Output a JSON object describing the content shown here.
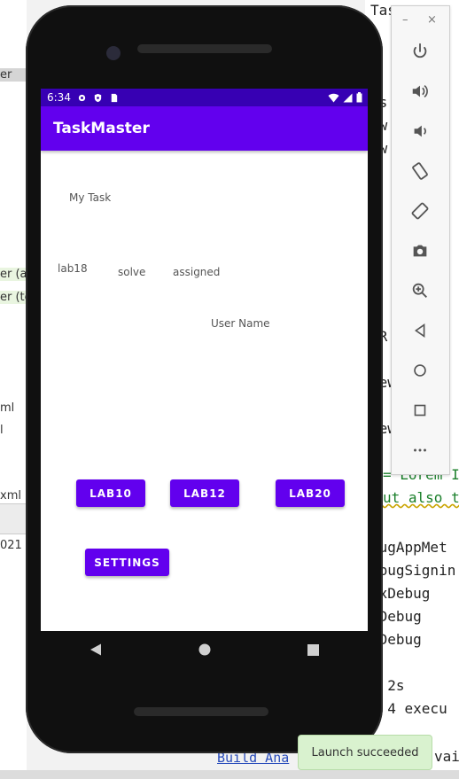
{
  "ide": {
    "left_rows": [
      {
        "text": "er",
        "style": "sel"
      },
      {
        "text": "er (ar",
        "style": "green"
      },
      {
        "text": "er (te",
        "style": "green"
      },
      {
        "text": "ml",
        "style": ""
      },
      {
        "text": "l",
        "style": ""
      },
      {
        "text": "xml",
        "style": ""
      },
      {
        "text": "021",
        "style": ""
      }
    ],
    "right_lines": [
      {
        "text": "Tas",
        "style": ""
      },
      {
        "text": "s",
        "style": ""
      },
      {
        "text": "s",
        "style": ""
      },
      {
        "text": "ks",
        "style": ""
      },
      {
        "text": "ow.",
        "style": ""
      },
      {
        "text": "ow.",
        "style": ""
      },
      {
        "text": "eR.",
        "style": ""
      },
      {
        "text": "tew",
        "style": ""
      },
      {
        "text": "Lew",
        "style": ""
      },
      {
        "text": "e",
        "style": ""
      },
      {
        "text": "= Lorem I",
        "style": "str"
      },
      {
        "text": "ut also t",
        "style": "str"
      },
      {
        "text": "bugAppMet",
        "style": ""
      },
      {
        "text": "ebugSignin",
        "style": ""
      },
      {
        "text": "exDebug",
        "style": ""
      },
      {
        "text": "eDebug",
        "style": ""
      },
      {
        "text": "eDebug",
        "style": ""
      },
      {
        "text": "n 2s",
        "style": ""
      },
      {
        "text": ": 4 execu",
        "style": ""
      },
      {
        "text": "vai",
        "style": ""
      }
    ],
    "build_link": "Build Ana",
    "toast": "Launch succeeded"
  },
  "emulator_toolbar": {
    "minimize": "–",
    "close": "×",
    "buttons": [
      "power-icon",
      "volume-up-icon",
      "volume-down-icon",
      "rotate-left-icon",
      "rotate-right-icon",
      "camera-icon",
      "zoom-icon",
      "back-icon",
      "home-icon",
      "overview-icon",
      "more-icon"
    ]
  },
  "phone": {
    "status_time": "6:34",
    "app_title": "TaskMaster",
    "texts": {
      "my_task": "My Task",
      "lab18": "lab18",
      "solve": "solve",
      "assigned": "assigned",
      "user_name": "User Name"
    },
    "buttons": {
      "lab10": "LAB10",
      "lab12": "LAB12",
      "lab20": "LAB20",
      "settings": "SETTINGS"
    }
  },
  "colors": {
    "status_bar": "#3700b3",
    "primary": "#6200ee"
  }
}
